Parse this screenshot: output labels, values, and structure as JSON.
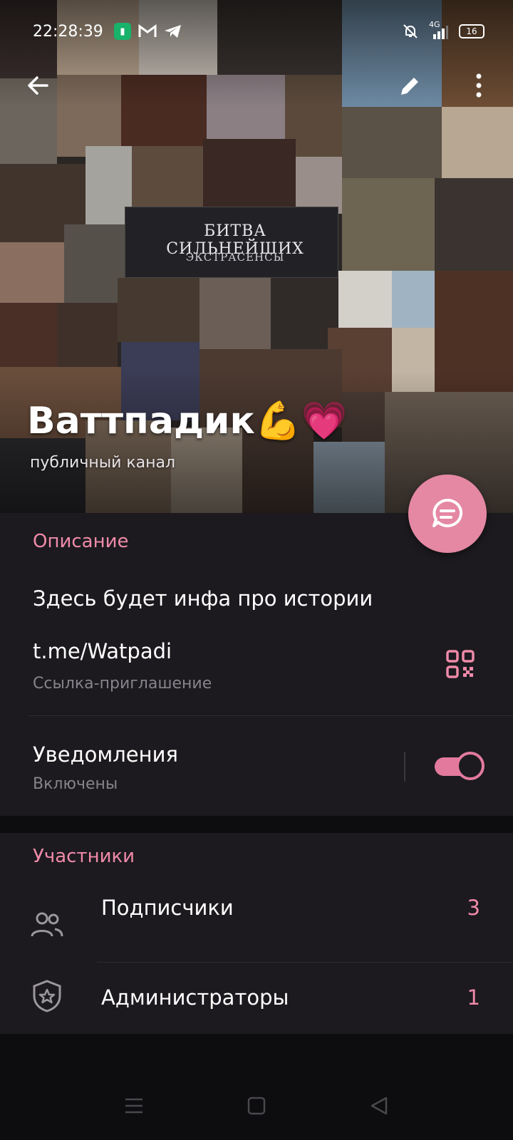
{
  "status_bar": {
    "time": "22:28:39",
    "network": "4G",
    "battery": "16",
    "notification_icons": [
      "app-badge-icon",
      "mail-icon",
      "telegram-icon"
    ],
    "system_icons": [
      "bell-muted-icon",
      "signal-icon",
      "battery-icon"
    ]
  },
  "header": {
    "channel_name": "Ваттпадик💪💗",
    "channel_type": "публичный канал",
    "banner_title": "БИТВА СИЛЬНЕЙШИХ",
    "banner_subtitle": "ЭКСТРАСЕНСЫ"
  },
  "info": {
    "description_title": "Описание",
    "description_text": "Здесь будет инфа про истории",
    "link": "t.me/Watpadi",
    "link_caption": "Ссылка-приглашение",
    "notifications_title": "Уведомления",
    "notifications_status": "Включены",
    "notifications_enabled": true
  },
  "members": {
    "title": "Участники",
    "subscribers_label": "Подписчики",
    "subscribers_count": "3",
    "admins_label": "Администраторы",
    "admins_count": "1"
  },
  "colors": {
    "accent": "#f08aa9",
    "fab": "#e488a3",
    "card_bg": "#1c1a1e",
    "page_bg": "#0d0c0e"
  }
}
